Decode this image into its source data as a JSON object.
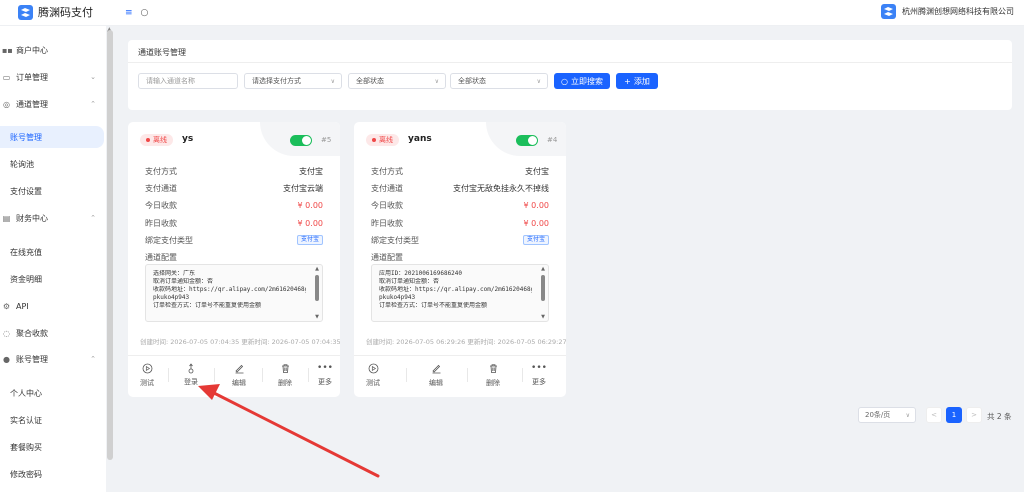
{
  "app": {
    "title": "腾渊码支付",
    "company": "杭州腾渊创想网络科技有限公司"
  },
  "topbar": {
    "menu_icon": "menu-icon",
    "search_icon": "search-icon"
  },
  "sidebar": {
    "items": [
      {
        "label": "商户中心",
        "icon": "grid-icon"
      },
      {
        "label": "订单管理",
        "icon": "order-icon"
      },
      {
        "label": "通道管理",
        "icon": "channel-icon"
      },
      {
        "label": "账号管理"
      },
      {
        "label": "轮询池"
      },
      {
        "label": "支付设置"
      },
      {
        "label": "财务中心",
        "icon": "finance-icon"
      },
      {
        "label": "在线充值"
      },
      {
        "label": "资金明细"
      },
      {
        "label": "API",
        "icon": "api-icon"
      },
      {
        "label": "聚合收款",
        "icon": "collect-icon"
      },
      {
        "label": "账号管理",
        "icon": "user-icon"
      },
      {
        "label": "个人中心"
      },
      {
        "label": "实名认证"
      },
      {
        "label": "套餐购买"
      },
      {
        "label": "修改密码"
      }
    ]
  },
  "panel": {
    "title": "通道账号管理",
    "name_placeholder": "请输入通道名称",
    "pay_method_placeholder": "请选择支付方式",
    "status_1": "全部状态",
    "status_2": "全部状态",
    "search_label": "立即搜索",
    "add_label": "添加"
  },
  "cards": [
    {
      "status": "离线",
      "name": "ys",
      "num": "#5",
      "enabled": true,
      "rows": [
        {
          "label": "支付方式",
          "value": "支付宝"
        },
        {
          "label": "支付通道",
          "value": "支付宝云端"
        },
        {
          "label": "今日收款",
          "value": "¥ 0.00"
        },
        {
          "label": "昨日收款",
          "value": "¥ 0.00"
        },
        {
          "label": "绑定支付类型",
          "value": "支付宝"
        }
      ],
      "config_label": "通道配置",
      "config_lines": [
        "选择网关：广东",
        "取消订单通知金额：否",
        "收款码地址：https://qr.alipay.com/2m61620468gpa",
        "pkuko4p943",
        "订单检查方式：订单号不能重复使用金额"
      ],
      "time": "创建时间: 2026-07-05 07:04:35  更新时间: 2026-07-05 07:04:35",
      "actions": [
        {
          "label": "测试",
          "icon": "play-icon"
        },
        {
          "label": "登录",
          "icon": "login-icon"
        },
        {
          "label": "编辑",
          "icon": "edit-icon"
        },
        {
          "label": "删除",
          "icon": "trash-icon"
        },
        {
          "label": "更多",
          "icon": "more-icon"
        }
      ]
    },
    {
      "status": "离线",
      "name": "yans",
      "num": "#4",
      "enabled": true,
      "rows": [
        {
          "label": "支付方式",
          "value": "支付宝"
        },
        {
          "label": "支付通道",
          "value": "支付宝无敌免挂永久不掉线"
        },
        {
          "label": "今日收款",
          "value": "¥ 0.00"
        },
        {
          "label": "昨日收款",
          "value": "¥ 0.00"
        },
        {
          "label": "绑定支付类型",
          "value": "支付宝"
        }
      ],
      "config_label": "通道配置",
      "config_lines": [
        "应用ID：2021006169686240",
        "取消订单通知金额：否",
        "收款码地址：https://qr.alipay.com/2m61620468gpa",
        "pkuko4p943",
        "订单检查方式：订单号不能重复使用金额"
      ],
      "time": "创建时间: 2026-07-05 06:29:26  更新时间: 2026-07-05 06:29:27",
      "actions": [
        {
          "label": "测试",
          "icon": "play-icon"
        },
        {
          "label": "编辑",
          "icon": "edit-icon"
        },
        {
          "label": "删除",
          "icon": "trash-icon"
        },
        {
          "label": "更多",
          "icon": "more-icon"
        }
      ]
    }
  ],
  "pager": {
    "page_size": "20条/页",
    "current": "1",
    "total": "共 2 条"
  },
  "colors": {
    "primary": "#1a63ff",
    "danger": "#f04848",
    "success": "#1bbe5b",
    "annotation": "#e53935"
  }
}
